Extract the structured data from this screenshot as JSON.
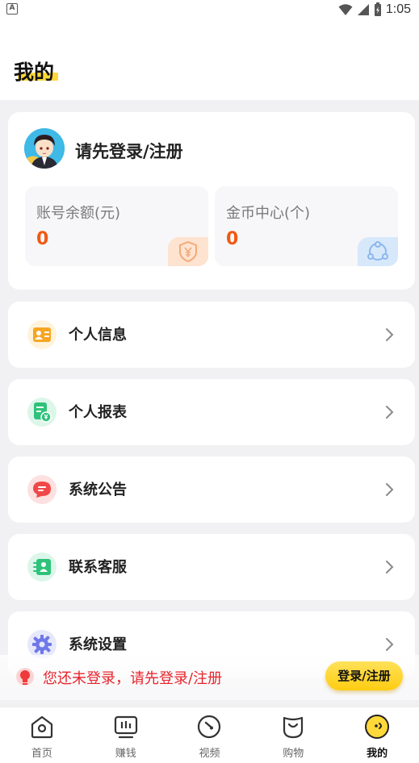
{
  "status_bar": {
    "time": "1:05",
    "notification_glyph": "A"
  },
  "header": {
    "title": "我的"
  },
  "profile": {
    "login_prompt": "请先登录/注册",
    "stats": [
      {
        "label": "账号余额(元)",
        "value": "0",
        "icon": "yuan-shield-icon"
      },
      {
        "label": "金币中心(个)",
        "value": "0",
        "icon": "coin-center-icon"
      }
    ]
  },
  "menu": [
    {
      "label": "个人信息",
      "icon": "id-card-icon",
      "color": "#f6a623"
    },
    {
      "label": "个人报表",
      "icon": "report-icon",
      "color": "#2fc27a"
    },
    {
      "label": "系统公告",
      "icon": "message-icon",
      "color": "#f04848"
    },
    {
      "label": "联系客服",
      "icon": "customer-service-icon",
      "color": "#2fc27a"
    },
    {
      "label": "系统设置",
      "icon": "settings-gear-icon",
      "color": "#6f78e8"
    }
  ],
  "login_banner": {
    "text": "您还未登录，请先登录/注册",
    "button": "登录/注册"
  },
  "tabs": [
    {
      "label": "首页",
      "icon": "home-icon",
      "active": false
    },
    {
      "label": "赚钱",
      "icon": "earn-icon",
      "active": false
    },
    {
      "label": "视频",
      "icon": "video-icon",
      "active": false
    },
    {
      "label": "购物",
      "icon": "shopping-icon",
      "active": false
    },
    {
      "label": "我的",
      "icon": "profile-face-icon",
      "active": true
    }
  ],
  "colors": {
    "accent_yellow": "#ffd83a",
    "value_orange": "#f05a14",
    "warning_red": "#e8242c"
  }
}
